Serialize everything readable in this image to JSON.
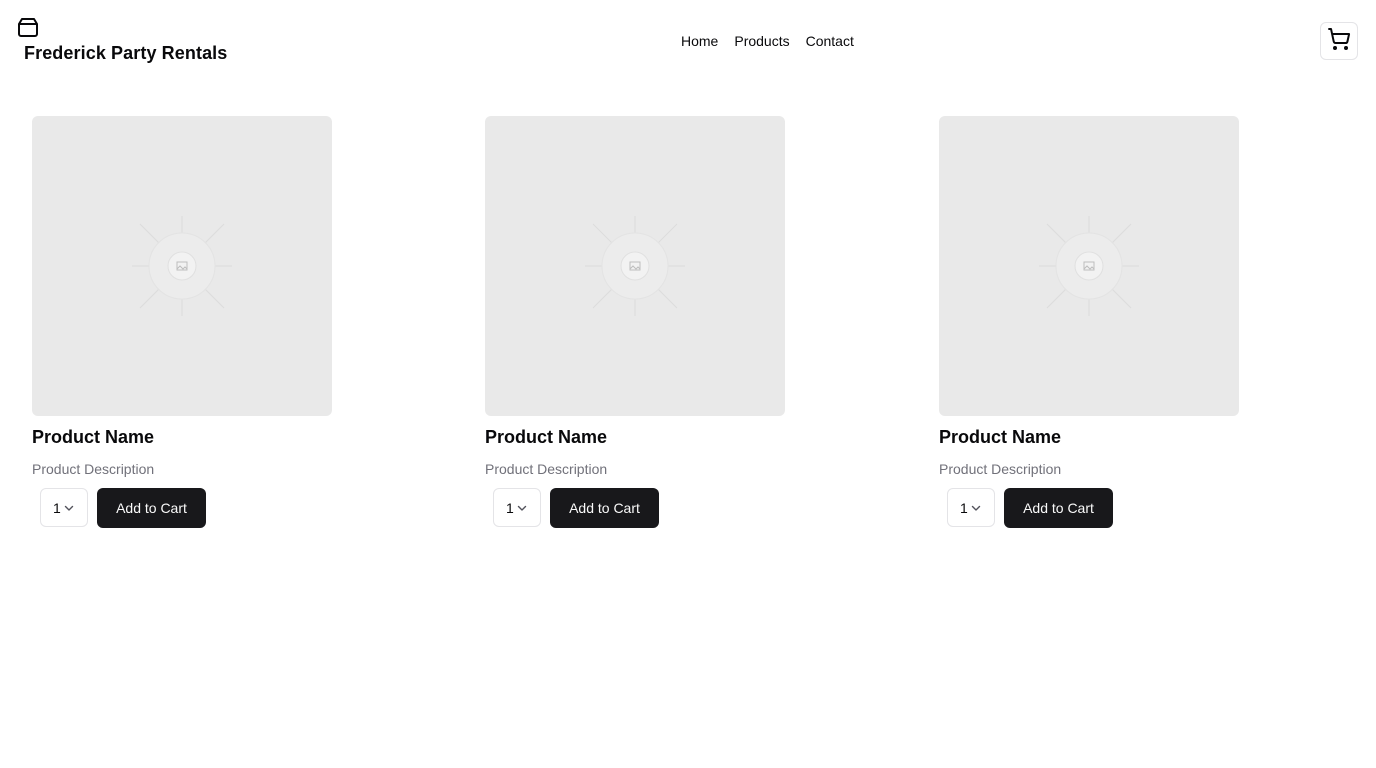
{
  "header": {
    "brand": "Frederick Party Rentals",
    "logo_icon": "package-icon",
    "nav": [
      "Home",
      "Products",
      "Contact"
    ],
    "cart_icon": "shopping-cart-icon"
  },
  "products": [
    {
      "name": "Product Name",
      "description": "Product Description",
      "quantity": "1",
      "add_label": "Add to Cart",
      "image_icon": "image-placeholder-icon"
    },
    {
      "name": "Product Name",
      "description": "Product Description",
      "quantity": "1",
      "add_label": "Add to Cart",
      "image_icon": "image-placeholder-icon"
    },
    {
      "name": "Product Name",
      "description": "Product Description",
      "quantity": "1",
      "add_label": "Add to Cart",
      "image_icon": "image-placeholder-icon"
    }
  ],
  "colors": {
    "primary_button": "#18181b",
    "muted_text": "#71717a",
    "image_placeholder": "#e9e9e9",
    "border": "#e4e4e7"
  }
}
